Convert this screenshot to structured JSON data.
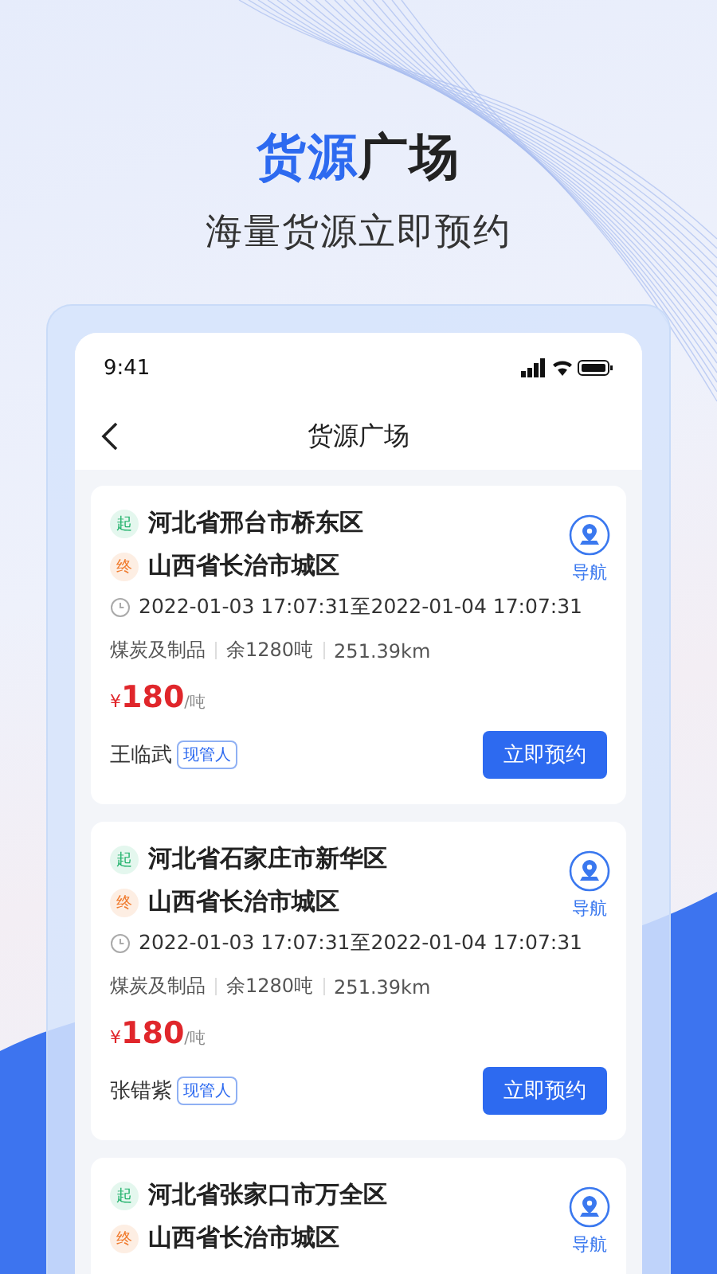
{
  "headline": {
    "highlight": "货源",
    "rest": "广场"
  },
  "subtitle": "海量货源立即预约",
  "status_bar": {
    "time": "9:41"
  },
  "nav_bar": {
    "title": "货源广场"
  },
  "cards": [
    {
      "from_tag": "起",
      "from": "河北省邢台市桥东区",
      "to_tag": "终",
      "to": "山西省长治市城区",
      "nav_label": "导航",
      "time_range": "2022-01-03 17:07:31至2022-01-04 17:07:31",
      "details": [
        "煤炭及制品",
        "余1280吨",
        "251.39km"
      ],
      "currency": "¥",
      "price": "180",
      "unit": "/吨",
      "contact": "王临武",
      "contact_tag": "现管人",
      "action": "立即预约"
    },
    {
      "from_tag": "起",
      "from": "河北省石家庄市新华区",
      "to_tag": "终",
      "to": "山西省长治市城区",
      "nav_label": "导航",
      "time_range": "2022-01-03 17:07:31至2022-01-04 17:07:31",
      "details": [
        "煤炭及制品",
        "余1280吨",
        "251.39km"
      ],
      "currency": "¥",
      "price": "180",
      "unit": "/吨",
      "contact": "张错紫",
      "contact_tag": "现管人",
      "action": "立即预约"
    },
    {
      "from_tag": "起",
      "from": "河北省张家口市万全区",
      "to_tag": "终",
      "to": "山西省长治市城区",
      "nav_label": "导航"
    }
  ]
}
